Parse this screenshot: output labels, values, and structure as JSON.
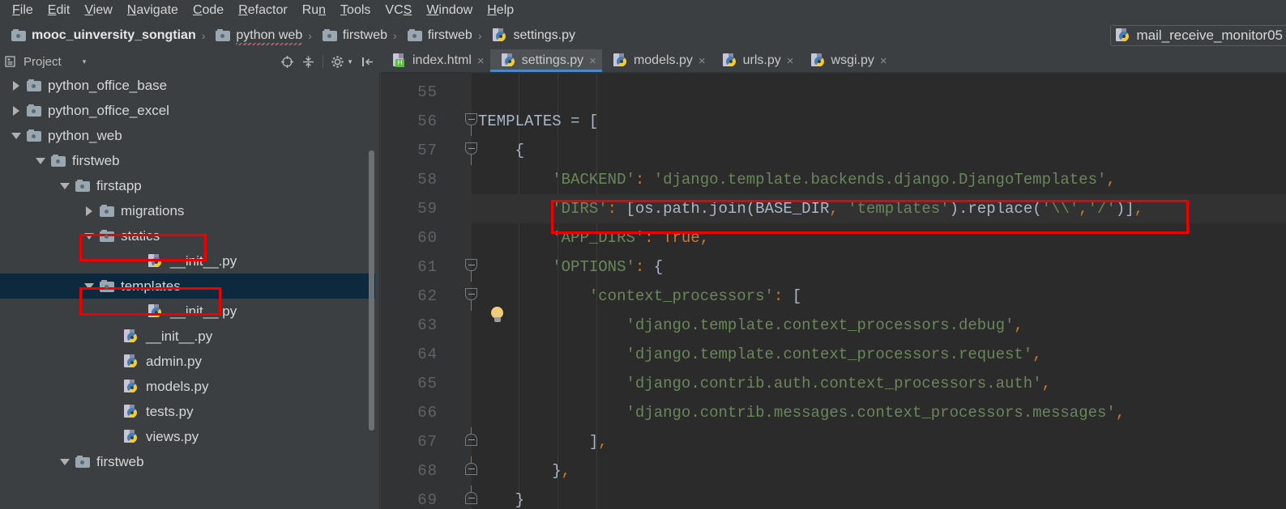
{
  "menubar": {
    "items": [
      {
        "label": "File",
        "mnemonic": "F"
      },
      {
        "label": "Edit",
        "mnemonic": "E"
      },
      {
        "label": "View",
        "mnemonic": "V"
      },
      {
        "label": "Navigate",
        "mnemonic": "N"
      },
      {
        "label": "Code",
        "mnemonic": "C"
      },
      {
        "label": "Refactor",
        "mnemonic": "R"
      },
      {
        "label": "Run",
        "mnemonic": "n"
      },
      {
        "label": "Tools",
        "mnemonic": "T"
      },
      {
        "label": "VCS",
        "mnemonic": "S"
      },
      {
        "label": "Window",
        "mnemonic": "W"
      },
      {
        "label": "Help",
        "mnemonic": "H"
      }
    ]
  },
  "breadcrumb": {
    "separator": "›",
    "items": [
      {
        "label": "mooc_uinversity_songtian",
        "icon": "folder-icon",
        "root": true
      },
      {
        "label": "python web",
        "icon": "folder-icon",
        "typo": true
      },
      {
        "label": "firstweb",
        "icon": "folder-icon"
      },
      {
        "label": "firstweb",
        "icon": "folder-icon"
      },
      {
        "label": "settings.py",
        "icon": "python-file-icon"
      }
    ]
  },
  "run_config": {
    "label": "mail_receive_monitor05",
    "icon": "python-file-icon"
  },
  "project_panel": {
    "title": "Project",
    "panel_icon": "project-icon",
    "caret": "▾",
    "tools": [
      {
        "name": "locate-icon"
      },
      {
        "name": "collapse-all-icon"
      },
      {
        "name": "divider"
      },
      {
        "name": "settings-gear-icon"
      },
      {
        "name": "hide-panel-icon"
      }
    ],
    "tree": [
      {
        "label": "python_office_base",
        "icon": "folder-icon",
        "arrow": "closed",
        "depth": 1,
        "selected": false
      },
      {
        "label": "python_office_excel",
        "icon": "folder-icon",
        "arrow": "closed",
        "depth": 1,
        "selected": false
      },
      {
        "label": "python_web",
        "icon": "folder-icon",
        "arrow": "open",
        "depth": 1,
        "selected": false,
        "typo": true
      },
      {
        "label": "firstweb",
        "icon": "folder-icon",
        "arrow": "open",
        "depth": 2,
        "selected": false
      },
      {
        "label": "firstapp",
        "icon": "folder-icon",
        "arrow": "open",
        "depth": 3,
        "selected": false
      },
      {
        "label": "migrations",
        "icon": "folder-icon",
        "arrow": "closed",
        "depth": 4,
        "selected": false
      },
      {
        "label": "statics",
        "icon": "folder-icon",
        "arrow": "open",
        "depth": 4,
        "selected": false,
        "highlighted": true
      },
      {
        "label": "__init__.py",
        "icon": "python-file-icon",
        "arrow": "none",
        "depth": 6,
        "selected": false
      },
      {
        "label": "templates",
        "icon": "folder-icon",
        "arrow": "open",
        "depth": 4,
        "selected": true,
        "highlighted": true
      },
      {
        "label": "__init__.py",
        "icon": "python-file-icon",
        "arrow": "none",
        "depth": 6,
        "selected": false
      },
      {
        "label": "__init__.py",
        "icon": "python-file-icon",
        "arrow": "none",
        "depth": 5,
        "selected": false
      },
      {
        "label": "admin.py",
        "icon": "python-file-icon",
        "arrow": "none",
        "depth": 5,
        "selected": false
      },
      {
        "label": "models.py",
        "icon": "python-file-icon",
        "arrow": "none",
        "depth": 5,
        "selected": false
      },
      {
        "label": "tests.py",
        "icon": "python-file-icon",
        "arrow": "none",
        "depth": 5,
        "selected": false
      },
      {
        "label": "views.py",
        "icon": "python-file-icon",
        "arrow": "none",
        "depth": 5,
        "selected": false
      },
      {
        "label": "firstweb",
        "icon": "folder-icon",
        "arrow": "open",
        "depth": 3,
        "selected": false
      }
    ]
  },
  "editor_tabs": [
    {
      "label": "index.html",
      "icon": "html-file-icon",
      "active": false,
      "close": "×"
    },
    {
      "label": "settings.py",
      "icon": "python-file-icon",
      "active": true,
      "close": "×"
    },
    {
      "label": "models.py",
      "icon": "python-file-icon",
      "active": false,
      "close": "×"
    },
    {
      "label": "urls.py",
      "icon": "python-file-icon",
      "active": false,
      "close": "×"
    },
    {
      "label": "wsgi.py",
      "icon": "python-file-icon",
      "active": false,
      "close": "×"
    }
  ],
  "editor": {
    "file": "settings.py",
    "current_line": 59,
    "intention_bulb": "lightbulb-icon",
    "lines": [
      {
        "num": "55",
        "text": "",
        "fold": "none"
      },
      {
        "num": "56",
        "text": "TEMPLATES = [",
        "fold": "top"
      },
      {
        "num": "57",
        "text": "    {",
        "fold": "top"
      },
      {
        "num": "58",
        "text": "        'BACKEND': 'django.template.backends.django.DjangoTemplates',",
        "fold": "none"
      },
      {
        "num": "59",
        "text": "        'DIRS': [os.path.join(BASE_DIR, 'templates').replace('\\\\','/')],",
        "fold": "none"
      },
      {
        "num": "60",
        "text": "        'APP_DIRS': True,",
        "fold": "none"
      },
      {
        "num": "61",
        "text": "        'OPTIONS': {",
        "fold": "top"
      },
      {
        "num": "62",
        "text": "            'context_processors': [",
        "fold": "top"
      },
      {
        "num": "63",
        "text": "                'django.template.context_processors.debug',",
        "fold": "none"
      },
      {
        "num": "64",
        "text": "                'django.template.context_processors.request',",
        "fold": "none"
      },
      {
        "num": "65",
        "text": "                'django.contrib.auth.context_processors.auth',",
        "fold": "none"
      },
      {
        "num": "66",
        "text": "                'django.contrib.messages.context_processors.messages',",
        "fold": "none"
      },
      {
        "num": "67",
        "text": "            ],",
        "fold": "bottom"
      },
      {
        "num": "68",
        "text": "        },",
        "fold": "bottom"
      },
      {
        "num": "69",
        "text": "    }",
        "fold": "bottom"
      }
    ]
  },
  "annotations": {
    "color": "#ee0000",
    "boxes": [
      {
        "name": "dirs-line-highlight",
        "target": "editor line 59"
      },
      {
        "name": "statics-folder-highlight",
        "target": "tree item statics"
      },
      {
        "name": "templates-folder-highlight",
        "target": "tree item templates"
      }
    ]
  },
  "colors": {
    "chrome_bg": "#3c3f41",
    "editor_bg": "#2b2b2b",
    "gutter_bg": "#313335",
    "selection_bg": "#0d293e",
    "tab_active_bg": "#4e5254",
    "tab_active_underline": "#4a88c7",
    "string_green": "#6a8759",
    "keyword_orange": "#cc7832",
    "text_grey": "#a9b7c6",
    "annotation_red": "#ee0000"
  }
}
